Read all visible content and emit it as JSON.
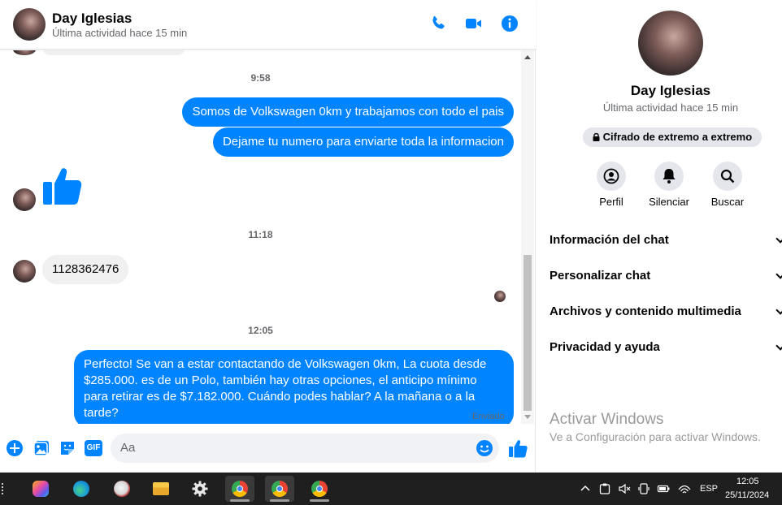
{
  "header": {
    "name": "Day Iglesias",
    "status": "Última actividad hace 15 min"
  },
  "messages": {
    "time1": "9:58",
    "out1": "Somos de Volkswagen 0km y trabajamos con todo el pais",
    "out2": "Dejame tu numero para enviarte toda la informacion",
    "time2": "11:18",
    "in1": "1128362476",
    "time3": "12:05",
    "out3": "Perfecto!  Se van a estar contactando de Volkswagen 0km, La cuota desde $285.000. es de un Polo, también hay otras opciones, el anticipo mínimo para retirar es de $7.182.000. Cuándo podes hablar? A la mañana o a la tarde?",
    "sent_label": "Enviado"
  },
  "composer": {
    "placeholder": "Aa",
    "gif_label": "GIF"
  },
  "info": {
    "name": "Day Iglesias",
    "status": "Última actividad hace 15 min",
    "encryption": "Cifrado de extremo a extremo",
    "actions": [
      {
        "label": "Perfil",
        "icon": "profile-icon"
      },
      {
        "label": "Silenciar",
        "icon": "bell-icon"
      },
      {
        "label": "Buscar",
        "icon": "search-icon"
      }
    ],
    "sections": [
      {
        "label": "Información del chat"
      },
      {
        "label": "Personalizar chat"
      },
      {
        "label": "Archivos y contenido multimedia"
      },
      {
        "label": "Privacidad y ayuda"
      }
    ]
  },
  "watermark": {
    "title": "Activar Windows",
    "subtitle": "Ve a Configuración para activar Windows."
  },
  "taskbar": {
    "language": "ESP",
    "time": "12:05",
    "date": "25/11/2024"
  },
  "colors": {
    "accent": "#0084ff",
    "incoming_bubble": "#f0f0f0",
    "taskbar": "#1f1f1f"
  }
}
